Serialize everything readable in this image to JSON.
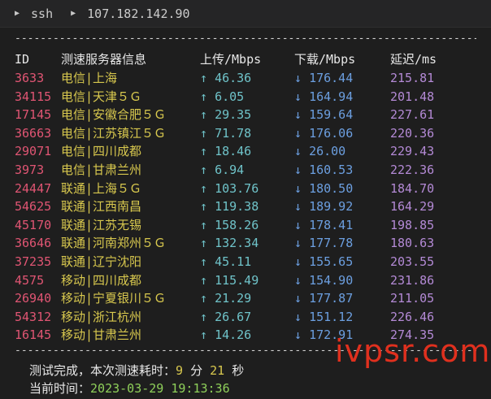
{
  "tab": {
    "segments": [
      "ssh",
      "107.182.142.90"
    ]
  },
  "separator": "--------------------------------------------------------------------------------",
  "header": {
    "id": "ID",
    "name": "测速服务器信息",
    "up": "上传/Mbps",
    "down": "下载/Mbps",
    "lat": "延迟/ms"
  },
  "up_arrow": "↑",
  "down_arrow": "↓",
  "rows": [
    {
      "id": "3633",
      "name": "电信|上海",
      "up": "46.36",
      "down": "176.44",
      "lat": "215.81"
    },
    {
      "id": "34115",
      "name": "电信|天津５Ｇ",
      "up": "6.05",
      "down": "164.94",
      "lat": "201.48"
    },
    {
      "id": "17145",
      "name": "电信|安徽合肥５Ｇ",
      "up": "29.35",
      "down": "159.64",
      "lat": "227.61"
    },
    {
      "id": "36663",
      "name": "电信|江苏镇江５Ｇ",
      "up": "71.78",
      "down": "176.06",
      "lat": "220.36"
    },
    {
      "id": "29071",
      "name": "电信|四川成都",
      "up": "18.46",
      "down": "26.00",
      "lat": "229.43"
    },
    {
      "id": "3973",
      "name": "电信|甘肃兰州",
      "up": "6.94",
      "down": "160.53",
      "lat": "222.36"
    },
    {
      "id": "24447",
      "name": "联通|上海５Ｇ",
      "up": "103.76",
      "down": "180.50",
      "lat": "184.70"
    },
    {
      "id": "54625",
      "name": "联通|江西南昌",
      "up": "119.38",
      "down": "189.92",
      "lat": "164.29"
    },
    {
      "id": "45170",
      "name": "联通|江苏无锡",
      "up": "158.26",
      "down": "178.41",
      "lat": "198.85"
    },
    {
      "id": "36646",
      "name": "联通|河南郑州５Ｇ",
      "up": "132.34",
      "down": "177.78",
      "lat": "180.63"
    },
    {
      "id": "37235",
      "name": "联通|辽宁沈阳",
      "up": "45.11",
      "down": "155.65",
      "lat": "203.55"
    },
    {
      "id": "4575",
      "name": "移动|四川成都",
      "up": "115.49",
      "down": "154.90",
      "lat": "231.86"
    },
    {
      "id": "26940",
      "name": "移动|宁夏银川５Ｇ",
      "up": "21.29",
      "down": "177.87",
      "lat": "211.05"
    },
    {
      "id": "54312",
      "name": "移动|浙江杭州",
      "up": "26.67",
      "down": "151.12",
      "lat": "226.46"
    },
    {
      "id": "16145",
      "name": "移动|甘肃兰州",
      "up": "14.26",
      "down": "172.91",
      "lat": "274.35"
    }
  ],
  "footer": {
    "done_label": "测试完成，本次测速耗时：",
    "minutes": "9",
    "min_unit": "分",
    "seconds": "21",
    "sec_unit": "秒",
    "time_label": "当前时间：",
    "timestamp": "2023-03-29 19:13:36"
  },
  "watermark": "ivpsr.com"
}
